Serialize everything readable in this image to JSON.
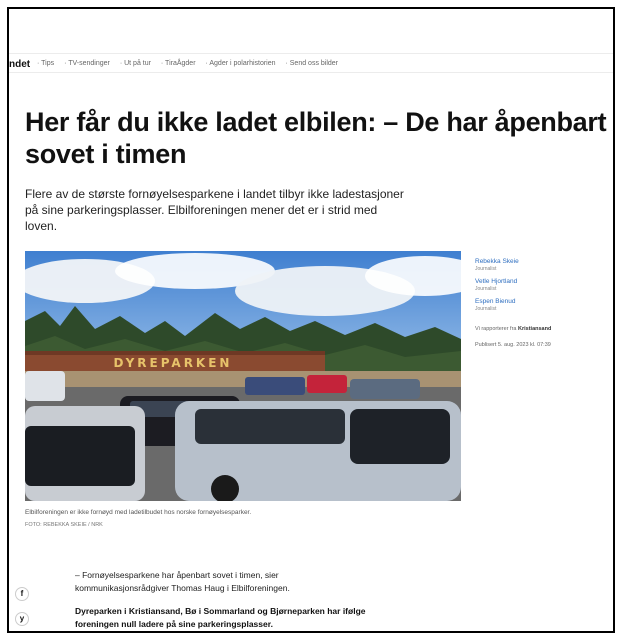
{
  "nav": {
    "brand": "ndet",
    "items": [
      "· Tips",
      "· TV-sendinger",
      "· Ut på tur",
      "· TiraÅgder",
      "· Agder i polarhistorien",
      "· Send oss bilder"
    ]
  },
  "article": {
    "headline": "Her får du ikke ladet elbilen: – De har åpenbart sovet i timen",
    "lead": "Flere av de største fornøyelsesparkene i landet tilbyr ikke ladestasjoner på sine parkeringsplasser. Elbilforeningen mener det er i strid med loven.",
    "photo_sign": "DYREPARKEN",
    "caption": "Elbilforeningen er ikke fornøyd med ladetilbudet hos norske fornøyelsesparker.",
    "credit": "FOTO: REBEKKA SKEIE / NRK",
    "body": [
      "– Fornøyelsesparkene har åpenbart sovet i timen, sier kommunikasjonsrådgiver Thomas Haug i Elbilforeningen.",
      "Dyreparken i Kristiansand, Bø i Sommarland og Bjørneparken har ifølge foreningen null ladere på sine parkeringsplasser."
    ]
  },
  "authors": [
    {
      "name": "Rebekka Skeie",
      "role": "Journalist"
    },
    {
      "name": "Vetle Hjortland",
      "role": "Journalist"
    },
    {
      "name": "Espen Bienud",
      "role": "Journalist"
    }
  ],
  "meta": {
    "location_prefix": "Vi rapporterer fra",
    "location": "Kristiansand",
    "published": "Publisert 5. aug. 2023 kl. 07:39"
  },
  "share": {
    "facebook_glyph": "f",
    "twitter_glyph": "y"
  }
}
